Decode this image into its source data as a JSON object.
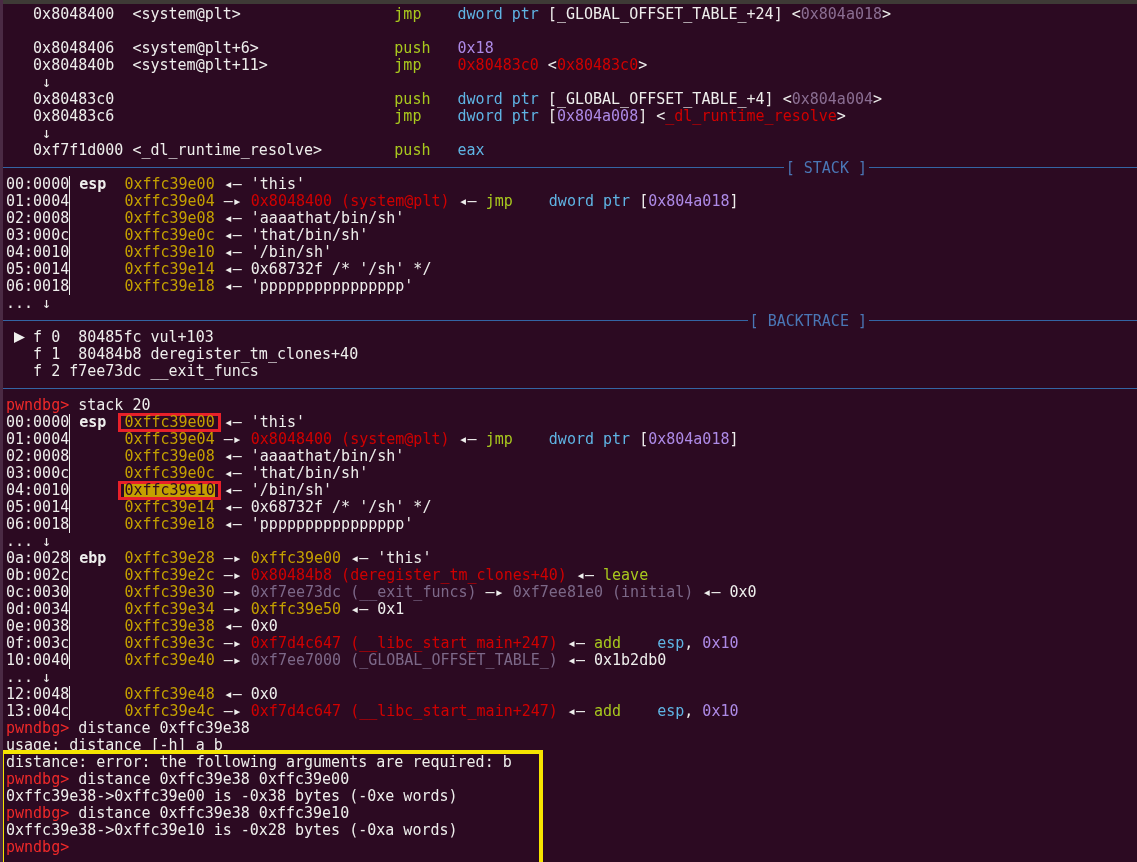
{
  "terminal": {
    "lines": [
      {
        "kind": "text",
        "segments": [
          {
            "text": "   0x8048400  <system@plt>                 ",
            "color": "#eeeeec"
          },
          {
            "text": "jmp",
            "color": "#a8c81e"
          },
          {
            "text": "    dword ptr",
            "color": "#5fb4e4"
          },
          {
            "text": " [_GLOBAL_OFFSET_TABLE_+24] <",
            "color": "#eeeeec"
          },
          {
            "text": "0x804a018",
            "color": "#8a6e92"
          },
          {
            "text": ">",
            "color": "#eeeeec"
          }
        ]
      },
      {
        "kind": "blank"
      },
      {
        "kind": "text",
        "segments": [
          {
            "text": "   0x8048406  <system@plt+6>               ",
            "color": "#eeeeec"
          },
          {
            "text": "push",
            "color": "#a8c81e"
          },
          {
            "text": "   0x18",
            "color": "#ad8ae6"
          }
        ]
      },
      {
        "kind": "text",
        "segments": [
          {
            "text": "   0x804840b  <system@plt+11>              ",
            "color": "#eeeeec"
          },
          {
            "text": "jmp",
            "color": "#a8c81e"
          },
          {
            "text": "    0x80483c0",
            "color": "#d00000"
          },
          {
            "text": " <",
            "color": "#eeeeec"
          },
          {
            "text": "0x80483c0",
            "color": "#d00000"
          },
          {
            "text": ">",
            "color": "#eeeeec"
          }
        ]
      },
      {
        "kind": "text",
        "segments": [
          {
            "text": "    ↓",
            "color": "#eeeeec"
          }
        ]
      },
      {
        "kind": "text",
        "segments": [
          {
            "text": "   0x80483c0                               ",
            "color": "#eeeeec"
          },
          {
            "text": "push",
            "color": "#a8c81e"
          },
          {
            "text": "   dword ptr",
            "color": "#5fb4e4"
          },
          {
            "text": " [_GLOBAL_OFFSET_TABLE_+4] <",
            "color": "#eeeeec"
          },
          {
            "text": "0x804a004",
            "color": "#8a6e92"
          },
          {
            "text": ">",
            "color": "#eeeeec"
          }
        ]
      },
      {
        "kind": "text",
        "segments": [
          {
            "text": "   0x80483c6                               ",
            "color": "#eeeeec"
          },
          {
            "text": "jmp",
            "color": "#a8c81e"
          },
          {
            "text": "    dword ptr",
            "color": "#5fb4e4"
          },
          {
            "text": " [",
            "color": "#eeeeec"
          },
          {
            "text": "0x804a008",
            "color": "#ad8ae6"
          },
          {
            "text": "] <",
            "color": "#eeeeec"
          },
          {
            "text": "_dl_runtime_resolve",
            "color": "#d00000"
          },
          {
            "text": ">",
            "color": "#eeeeec"
          }
        ]
      },
      {
        "kind": "text",
        "segments": [
          {
            "text": "    ↓",
            "color": "#eeeeec"
          }
        ]
      },
      {
        "kind": "text",
        "segments": [
          {
            "text": "   0xf7f1d000 <_dl_runtime_resolve>        ",
            "color": "#eeeeec"
          },
          {
            "text": "push",
            "color": "#a8c81e"
          },
          {
            "text": "   eax",
            "color": "#5fb4e4"
          }
        ]
      },
      {
        "kind": "rule",
        "label": "[ STACK ]"
      },
      {
        "kind": "stack",
        "offset": "00:0000",
        "register": "esp",
        "address": "0xffc39e00",
        "boxed": false,
        "highlighted": false,
        "segments": [
          {
            "text": " ◂— 'this'",
            "color": "#eeeeec"
          }
        ]
      },
      {
        "kind": "stack",
        "offset": "01:0004",
        "address": "0xffc39e04",
        "boxed": false,
        "highlighted": false,
        "segments": [
          {
            "text": " —▸ ",
            "color": "#eeeeec"
          },
          {
            "text": "0x8048400 (system@plt)",
            "color": "#d00000"
          },
          {
            "text": " ◂— ",
            "color": "#eeeeec"
          },
          {
            "text": "jmp",
            "color": "#a8c81e"
          },
          {
            "text": "    dword ptr",
            "color": "#5fb4e4"
          },
          {
            "text": " [",
            "color": "#eeeeec"
          },
          {
            "text": "0x804a018",
            "color": "#ad8ae6"
          },
          {
            "text": "]",
            "color": "#eeeeec"
          }
        ]
      },
      {
        "kind": "stack",
        "offset": "02:0008",
        "address": "0xffc39e08",
        "boxed": false,
        "highlighted": false,
        "segments": [
          {
            "text": " ◂— 'aaaathat/bin/sh'",
            "color": "#eeeeec"
          }
        ]
      },
      {
        "kind": "stack",
        "offset": "03:000c",
        "address": "0xffc39e0c",
        "boxed": false,
        "highlighted": false,
        "segments": [
          {
            "text": " ◂— 'that/bin/sh'",
            "color": "#eeeeec"
          }
        ]
      },
      {
        "kind": "stack",
        "offset": "04:0010",
        "address": "0xffc39e10",
        "boxed": false,
        "highlighted": false,
        "segments": [
          {
            "text": " ◂— '/bin/sh'",
            "color": "#eeeeec"
          }
        ]
      },
      {
        "kind": "stack",
        "offset": "05:0014",
        "address": "0xffc39e14",
        "boxed": false,
        "highlighted": false,
        "segments": [
          {
            "text": " ◂— 0x68732f /* '/sh' */",
            "color": "#eeeeec"
          }
        ]
      },
      {
        "kind": "stack",
        "offset": "06:0018",
        "address": "0xffc39e18",
        "boxed": false,
        "highlighted": false,
        "segments": [
          {
            "text": " ◂— 'pppppppppppppppp'",
            "color": "#eeeeec"
          }
        ]
      },
      {
        "kind": "text",
        "segments": [
          {
            "text": "... ↓",
            "color": "#eeeeec"
          }
        ]
      },
      {
        "kind": "rule",
        "label": "[ BACKTRACE ]"
      },
      {
        "kind": "frame",
        "selected": true,
        "segments": [
          {
            "text": "f 0  80485fc vul+103",
            "color": "#eeeeec"
          }
        ]
      },
      {
        "kind": "frame",
        "selected": false,
        "segments": [
          {
            "text": "f 1  80484b8 deregister_tm_clones+40",
            "color": "#eeeeec"
          }
        ]
      },
      {
        "kind": "frame",
        "selected": false,
        "segments": [
          {
            "text": "f 2 f7ee73dc __exit_funcs",
            "color": "#eeeeec"
          }
        ]
      },
      {
        "kind": "rule"
      },
      {
        "kind": "text",
        "segments": [
          {
            "text": "pwndbg>",
            "color": "#ef2929"
          },
          {
            "text": " stack 20",
            "color": "#eeeeec"
          }
        ]
      },
      {
        "kind": "stack",
        "offset": "00:0000",
        "register": "esp",
        "address": "0xffc39e00",
        "boxed": true,
        "highlighted": false,
        "segments": [
          {
            "text": " ◂— 'this'",
            "color": "#eeeeec"
          }
        ]
      },
      {
        "kind": "stack",
        "offset": "01:0004",
        "address": "0xffc39e04",
        "boxed": false,
        "highlighted": false,
        "segments": [
          {
            "text": " —▸ ",
            "color": "#eeeeec"
          },
          {
            "text": "0x8048400 (system@plt)",
            "color": "#d00000"
          },
          {
            "text": " ◂— ",
            "color": "#eeeeec"
          },
          {
            "text": "jmp",
            "color": "#a8c81e"
          },
          {
            "text": "    dword ptr",
            "color": "#5fb4e4"
          },
          {
            "text": " [",
            "color": "#eeeeec"
          },
          {
            "text": "0x804a018",
            "color": "#ad8ae6"
          },
          {
            "text": "]",
            "color": "#eeeeec"
          }
        ]
      },
      {
        "kind": "stack",
        "offset": "02:0008",
        "address": "0xffc39e08",
        "boxed": false,
        "highlighted": false,
        "segments": [
          {
            "text": " ◂— 'aaaathat/bin/sh'",
            "color": "#eeeeec"
          }
        ]
      },
      {
        "kind": "stack",
        "offset": "03:000c",
        "address": "0xffc39e0c",
        "boxed": false,
        "highlighted": false,
        "segments": [
          {
            "text": " ◂— 'that/bin/sh'",
            "color": "#eeeeec"
          }
        ]
      },
      {
        "kind": "stack",
        "offset": "04:0010",
        "address": "0xffc39e10",
        "boxed": true,
        "highlighted": true,
        "segments": [
          {
            "text": " ◂— '/bin/sh'",
            "color": "#eeeeec"
          }
        ]
      },
      {
        "kind": "stack",
        "offset": "05:0014",
        "address": "0xffc39e14",
        "boxed": false,
        "highlighted": false,
        "segments": [
          {
            "text": " ◂— 0x68732f /* '/sh' */",
            "color": "#eeeeec"
          }
        ]
      },
      {
        "kind": "stack",
        "offset": "06:0018",
        "address": "0xffc39e18",
        "boxed": false,
        "highlighted": false,
        "segments": [
          {
            "text": " ◂— 'pppppppppppppppp'",
            "color": "#eeeeec"
          }
        ]
      },
      {
        "kind": "text",
        "segments": [
          {
            "text": "... ↓",
            "color": "#eeeeec"
          }
        ]
      },
      {
        "kind": "stack",
        "offset": "0a:0028",
        "register": "ebp",
        "address": "0xffc39e28",
        "boxed": false,
        "highlighted": false,
        "segments": [
          {
            "text": " —▸ ",
            "color": "#eeeeec"
          },
          {
            "text": "0xffc39e00",
            "color": "#c4a000"
          },
          {
            "text": " ◂— 'this'",
            "color": "#eeeeec"
          }
        ]
      },
      {
        "kind": "stack",
        "offset": "0b:002c",
        "address": "0xffc39e2c",
        "boxed": false,
        "highlighted": false,
        "segments": [
          {
            "text": " —▸ ",
            "color": "#eeeeec"
          },
          {
            "text": "0x80484b8 (deregister_tm_clones+40)",
            "color": "#d00000"
          },
          {
            "text": " ◂— ",
            "color": "#eeeeec"
          },
          {
            "text": "leave",
            "color": "#a8c81e"
          }
        ]
      },
      {
        "kind": "stack",
        "offset": "0c:0030",
        "address": "0xffc39e30",
        "boxed": false,
        "highlighted": false,
        "segments": [
          {
            "text": " —▸ ",
            "color": "#eeeeec"
          },
          {
            "text": "0xf7ee73dc (__exit_funcs)",
            "color": "#7c6888"
          },
          {
            "text": " —▸ ",
            "color": "#eeeeec"
          },
          {
            "text": "0xf7ee81e0 (initial)",
            "color": "#7c6888"
          },
          {
            "text": " ◂— 0x0",
            "color": "#eeeeec"
          }
        ]
      },
      {
        "kind": "stack",
        "offset": "0d:0034",
        "address": "0xffc39e34",
        "boxed": false,
        "highlighted": false,
        "segments": [
          {
            "text": " —▸ ",
            "color": "#eeeeec"
          },
          {
            "text": "0xffc39e50",
            "color": "#c4a000"
          },
          {
            "text": " ◂— 0x1",
            "color": "#eeeeec"
          }
        ]
      },
      {
        "kind": "stack",
        "offset": "0e:0038",
        "address": "0xffc39e38",
        "boxed": false,
        "highlighted": false,
        "segments": [
          {
            "text": " ◂— 0x0",
            "color": "#eeeeec"
          }
        ]
      },
      {
        "kind": "stack",
        "offset": "0f:003c",
        "address": "0xffc39e3c",
        "boxed": false,
        "highlighted": false,
        "segments": [
          {
            "text": " —▸ ",
            "color": "#eeeeec"
          },
          {
            "text": "0xf7d4c647 (__libc_start_main+247)",
            "color": "#d00000"
          },
          {
            "text": " ◂— ",
            "color": "#eeeeec"
          },
          {
            "text": "add",
            "color": "#a8c81e"
          },
          {
            "text": "    esp",
            "color": "#5fb4e4"
          },
          {
            "text": ", ",
            "color": "#eeeeec"
          },
          {
            "text": "0x10",
            "color": "#ad8ae6"
          }
        ]
      },
      {
        "kind": "stack",
        "offset": "10:0040",
        "address": "0xffc39e40",
        "boxed": false,
        "highlighted": false,
        "segments": [
          {
            "text": " —▸ ",
            "color": "#eeeeec"
          },
          {
            "text": "0xf7ee7000 (_GLOBAL_OFFSET_TABLE_)",
            "color": "#7c6888"
          },
          {
            "text": " ◂— 0x1b2db0",
            "color": "#eeeeec"
          }
        ]
      },
      {
        "kind": "text",
        "segments": [
          {
            "text": "... ↓",
            "color": "#eeeeec"
          }
        ]
      },
      {
        "kind": "stack",
        "offset": "12:0048",
        "address": "0xffc39e48",
        "boxed": false,
        "highlighted": false,
        "segments": [
          {
            "text": " ◂— 0x0",
            "color": "#eeeeec"
          }
        ]
      },
      {
        "kind": "stack",
        "offset": "13:004c",
        "address": "0xffc39e4c",
        "boxed": false,
        "highlighted": false,
        "segments": [
          {
            "text": " —▸ ",
            "color": "#eeeeec"
          },
          {
            "text": "0xf7d4c647 (__libc_start_main+247)",
            "color": "#d00000"
          },
          {
            "text": " ◂— ",
            "color": "#eeeeec"
          },
          {
            "text": "add",
            "color": "#a8c81e"
          },
          {
            "text": "    esp",
            "color": "#5fb4e4"
          },
          {
            "text": ", ",
            "color": "#eeeeec"
          },
          {
            "text": "0x10",
            "color": "#ad8ae6"
          }
        ]
      },
      {
        "kind": "text",
        "segments": [
          {
            "text": "pwndbg>",
            "color": "#ef2929"
          },
          {
            "text": " distance 0xffc39e38",
            "color": "#eeeeec"
          }
        ]
      },
      {
        "kind": "text",
        "segments": [
          {
            "text": "usage: distance [-h] a b",
            "color": "#eeeeec"
          }
        ]
      }
    ]
  },
  "framed_output": {
    "lines": [
      {
        "kind": "text",
        "segments": [
          {
            "text": "distance: error: the following arguments are required: b",
            "color": "#eeeeec"
          }
        ]
      },
      {
        "kind": "text",
        "segments": [
          {
            "text": "pwndbg>",
            "color": "#ef2929"
          },
          {
            "text": " distance 0xffc39e38 0xffc39e00",
            "color": "#eeeeec"
          }
        ]
      },
      {
        "kind": "text",
        "segments": [
          {
            "text": "0xffc39e38->0xffc39e00 is -0x38 bytes (-0xe words)",
            "color": "#eeeeec"
          }
        ]
      },
      {
        "kind": "text",
        "segments": [
          {
            "text": "pwndbg>",
            "color": "#ef2929"
          },
          {
            "text": " distance 0xffc39e38 0xffc39e10",
            "color": "#eeeeec"
          }
        ]
      },
      {
        "kind": "text",
        "segments": [
          {
            "text": "0xffc39e38->0xffc39e10 is -0x28 bytes (-0xa words)",
            "color": "#eeeeec"
          }
        ]
      },
      {
        "kind": "text",
        "segments": [
          {
            "text": "pwndbg>",
            "color": "#ef2929"
          }
        ]
      }
    ]
  }
}
